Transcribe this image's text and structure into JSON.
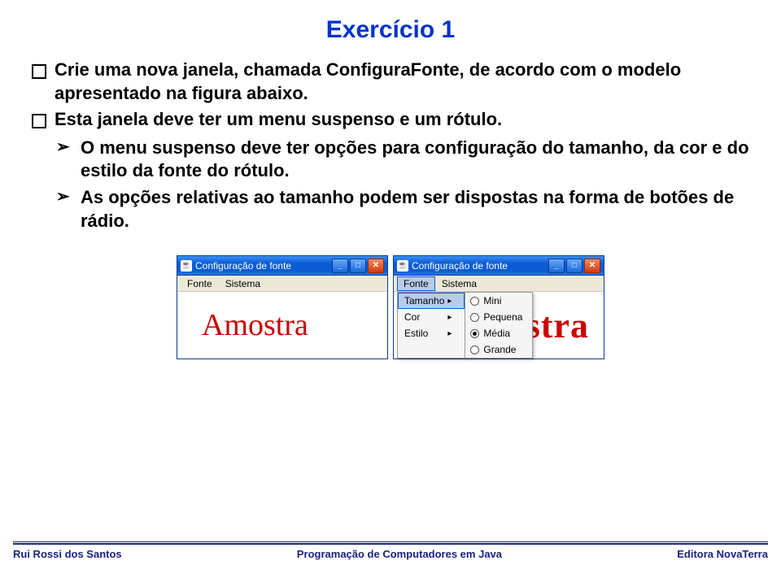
{
  "title": "Exercício 1",
  "bullets": {
    "b1": "Crie uma nova janela, chamada ConfiguraFonte, de acordo com o modelo apresentado na figura abaixo.",
    "b2": "Esta janela deve ter um menu suspenso e um rótulo.",
    "s1": "O menu suspenso deve ter opções para configuração do tamanho, da cor e do estilo da fonte do rótulo.",
    "s2": "As opções relativas ao tamanho podem ser dispostas na forma de botões de rádio."
  },
  "window": {
    "icon": "☕",
    "title_text": "Configuração de fonte",
    "menus": {
      "fonte": "Fonte",
      "sistema": "Sistema"
    },
    "amostra": "Amostra",
    "amostra2": "stra",
    "submenu": {
      "tamanho": "Tamanho",
      "cor": "Cor",
      "estilo": "Estilo"
    },
    "sizes": {
      "mini": "Mini",
      "pequena": "Pequena",
      "media": "Média",
      "grande": "Grande"
    },
    "btn": {
      "min": "_",
      "max": "□",
      "close": "✕"
    },
    "arrow": "▸"
  },
  "footer": {
    "left": "Rui Rossi dos Santos",
    "center": "Programação de Computadores em Java",
    "right": "Editora NovaTerra"
  }
}
